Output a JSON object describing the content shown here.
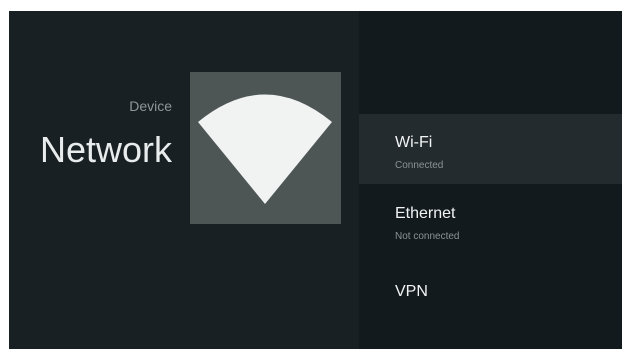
{
  "header": {
    "breadcrumb": "Device",
    "title": "Network"
  },
  "hero": {
    "icon": "wifi-icon"
  },
  "menu": {
    "items": [
      {
        "label": "Wi-Fi",
        "status": "Connected",
        "selected": true
      },
      {
        "label": "Ethernet",
        "status": "Not connected",
        "selected": false
      },
      {
        "label": "VPN",
        "status": "",
        "selected": false
      }
    ]
  },
  "colors": {
    "background": "#161d20",
    "left_panel": "#192023",
    "right_panel": "#131a1d",
    "selected_row": "#242b2e",
    "icon_tile": "#4e5555",
    "icon_fill": "#f1f3f3"
  }
}
